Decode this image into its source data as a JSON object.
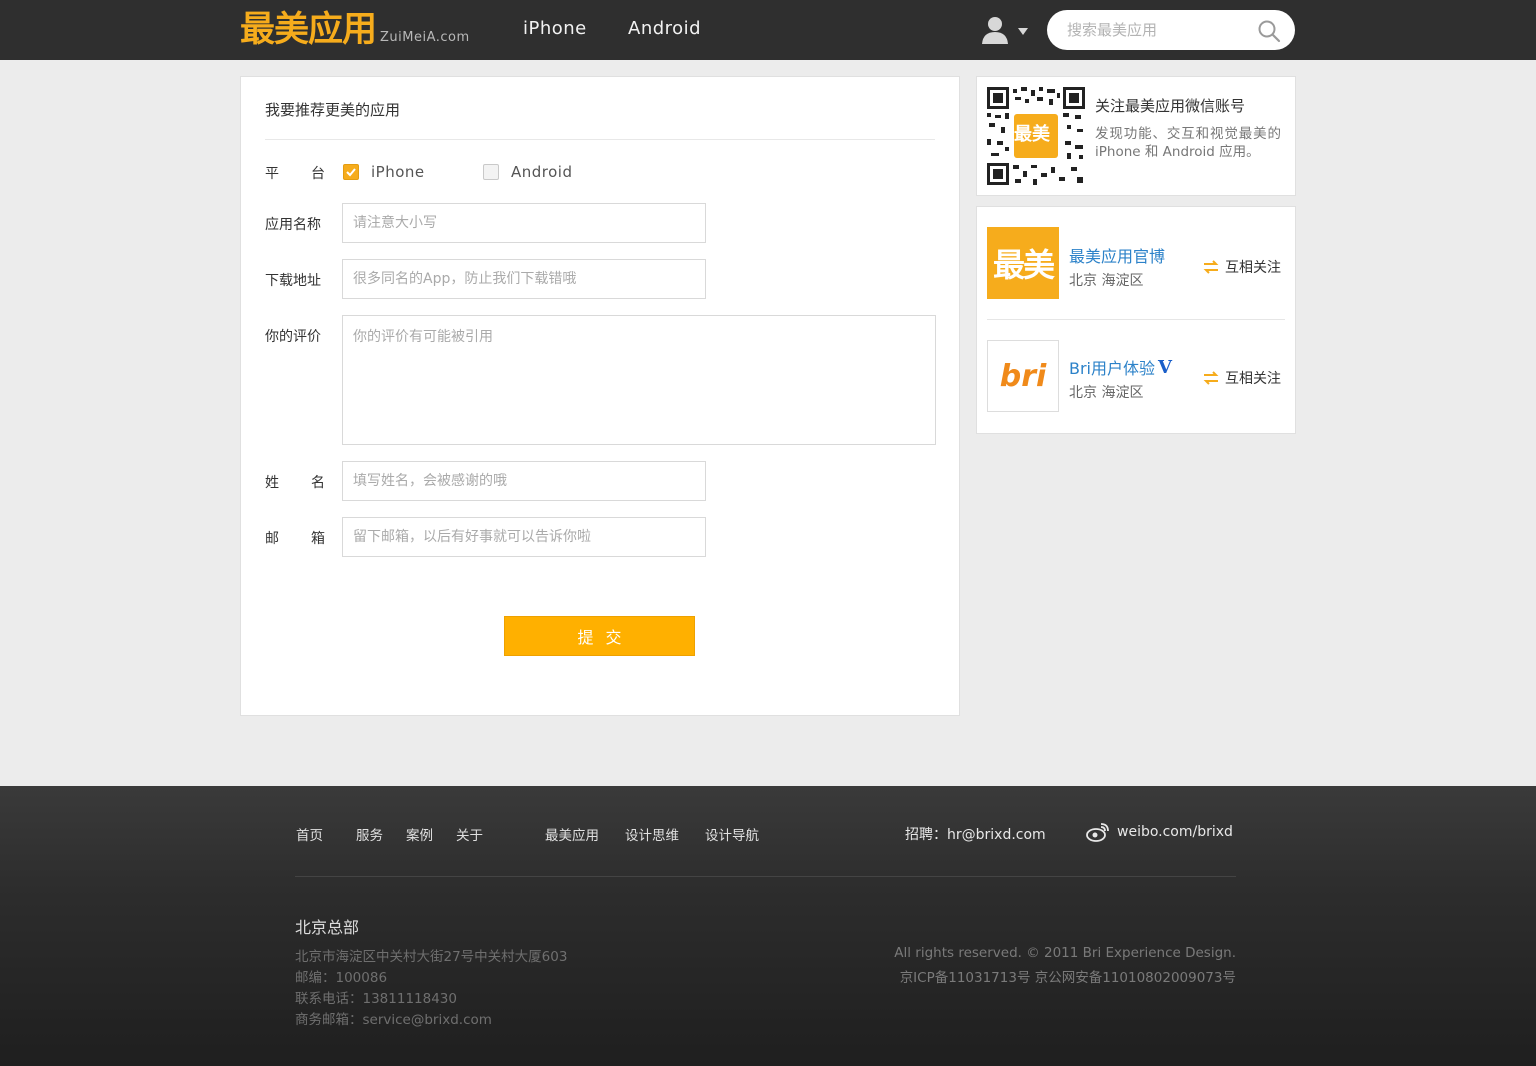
{
  "header": {
    "logo_cn": "最美应用",
    "logo_en": "ZuiMeiA.com",
    "nav": [
      "iPhone",
      "Android"
    ],
    "search_placeholder": "搜索最美应用",
    "brand_color": "#f6ac1c"
  },
  "form": {
    "title": "我要推荐更美的应用",
    "platform_label": [
      "平",
      "台"
    ],
    "platforms": [
      {
        "label": "iPhone",
        "checked": true
      },
      {
        "label": "Android",
        "checked": false
      }
    ],
    "fields": [
      {
        "label": "应用名称",
        "placeholder": "请注意大小写"
      },
      {
        "label": "下载地址",
        "placeholder": "很多同名的App，防止我们下载错哦"
      },
      {
        "label": "你的评价",
        "placeholder": "你的评价有可能被引用"
      }
    ],
    "name_label": [
      "姓",
      "名"
    ],
    "name_placeholder": "填写姓名，会被感谢的哦",
    "email_label": [
      "邮",
      "箱"
    ],
    "email_placeholder": "留下邮箱，以后有好事就可以告诉你啦",
    "submit": "提交"
  },
  "sidebar": {
    "wechat_title": "关注最美应用微信账号",
    "wechat_desc": "发现功能、交互和视觉最美的 iPhone 和 Android 应用。",
    "qr_logo": "最美",
    "weibo": [
      {
        "avatar_text": "最美",
        "name": "最美应用官博",
        "location": "北京 海淀区",
        "follow": "互相关注",
        "verified": false
      },
      {
        "avatar_text": "bri",
        "name": "Bri用户体验",
        "location": "北京 海淀区",
        "follow": "互相关注",
        "verified": true
      }
    ]
  },
  "footer": {
    "links_a": [
      "首页",
      "服务",
      "案例",
      "关于"
    ],
    "links_b": [
      "最美应用",
      "设计思维",
      "设计导航"
    ],
    "recruit": "招聘：hr@brixd.com",
    "weibo": "weibo.com/brixd",
    "hq_title": "北京总部",
    "address_lines": [
      "北京市海淀区中关村大街27号中关村大厦603",
      "邮编：100086",
      "联系电话：13811118430",
      "商务邮箱：service@brixd.com"
    ],
    "copyright": "All rights reserved. © 2011 Bri Experience Design.",
    "icp": "京ICP备11031713号 京公网安备11010802009073号"
  }
}
